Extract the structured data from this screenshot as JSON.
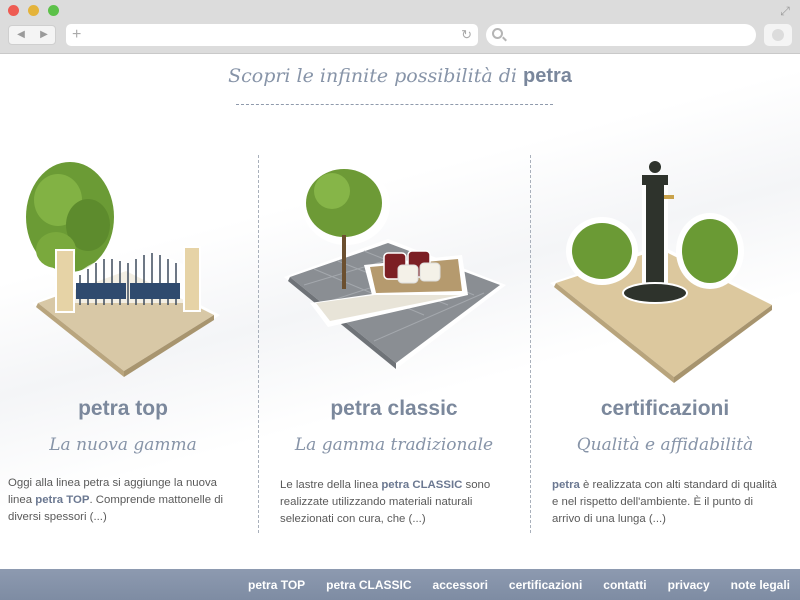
{
  "page": {
    "headline_prefix": "Scopri le infinite possibilità di",
    "headline_brand": "petra"
  },
  "columns": [
    {
      "title": "petra top",
      "subtitle": "La nuova gamma",
      "text_pre": "Oggi alla linea petra si aggiunge la nuova linea ",
      "text_brand": "petra TOP",
      "text_post": ". Comprende mattonelle di diversi spessori (...)"
    },
    {
      "title": "petra classic",
      "subtitle": "La gamma tradizionale",
      "text_pre": "Le lastre della linea ",
      "text_brand": "petra CLASSIC",
      "text_post": " sono realizzate utilizzando materiali naturali selezionati con cura, che (...)"
    },
    {
      "title": "certificazioni",
      "subtitle": "Qualità e affidabilità",
      "text_pre": "",
      "text_brand": "petra",
      "text_post": " è realizzata con alti standard di qualità e nel rispetto dell'ambiente. È il punto di arrivo di una lunga (...)"
    }
  ],
  "footer": {
    "links": [
      "petra TOP",
      "petra CLASSIC",
      "accessori",
      "certificazioni",
      "contatti",
      "privacy",
      "note legali"
    ]
  },
  "icons": {
    "back": "chevron-left-icon",
    "forward": "chevron-right-icon",
    "reload": "reload-icon",
    "search": "search-icon"
  }
}
